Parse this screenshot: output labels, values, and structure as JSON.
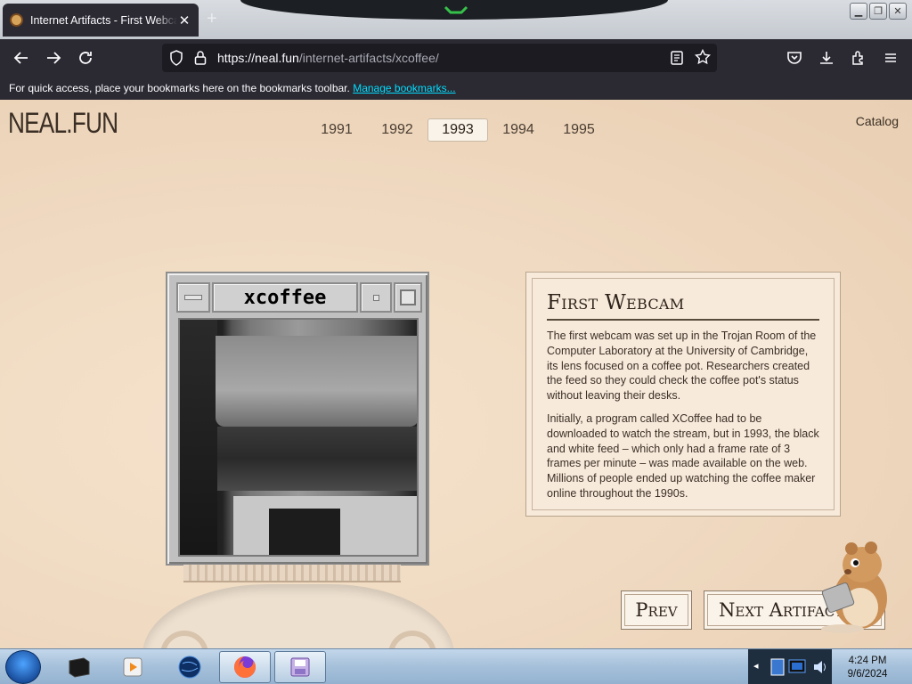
{
  "browser": {
    "tab_title": "Internet Artifacts - First Webcam",
    "url_host": "https://neal.fun",
    "url_path": "/internet-artifacts/xcoffee/",
    "bookmarks_text": "For quick access, place your bookmarks here on the bookmarks toolbar.",
    "bookmarks_link": "Manage bookmarks..."
  },
  "site": {
    "logo": "NEAL.FUN",
    "catalog": "Catalog",
    "years": [
      "1991",
      "1992",
      "1993",
      "1994",
      "1995"
    ],
    "active_year": "1993"
  },
  "xcoffee": {
    "window_title": "xcoffee"
  },
  "info": {
    "heading": "First Webcam",
    "para1": "The first webcam was set up in the Trojan Room of the Computer Laboratory at the University of Cambridge, its lens focused on a coffee pot. Researchers created the feed so they could check the coffee pot's status without leaving their desks.",
    "para2": "Initially, a program called XCoffee had to be downloaded to watch the stream, but in 1993, the black and white feed – which only had a frame rate of 3 frames per minute – was made available on the web. Millions of people ended up watching the coffee maker online throughout the 1990s."
  },
  "nav": {
    "prev": "Prev",
    "next": "Next Artifact"
  },
  "taskbar": {
    "time": "4:24 PM",
    "date": "9/6/2024"
  }
}
